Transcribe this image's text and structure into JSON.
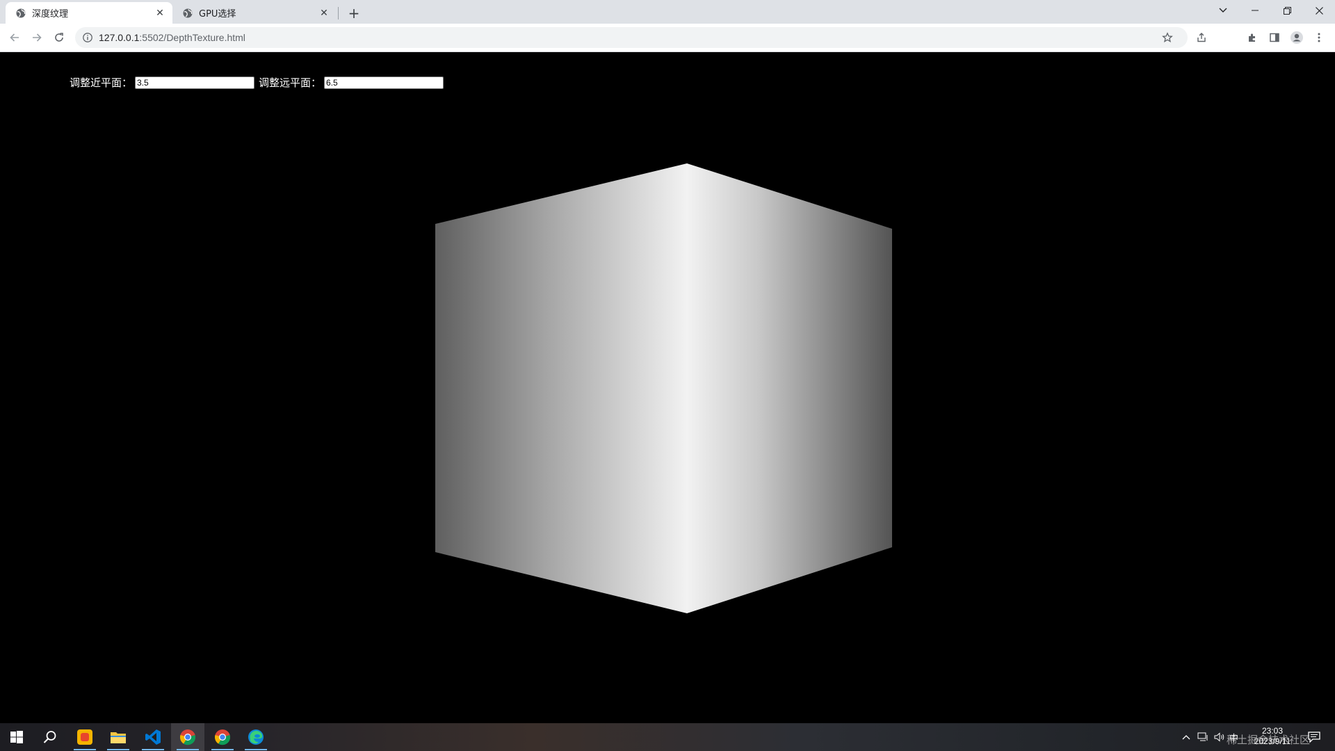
{
  "browser": {
    "tabs": [
      {
        "title": "深度纹理",
        "active": true
      },
      {
        "title": "GPU选择",
        "active": false
      }
    ],
    "new_tab_label": "+",
    "address": {
      "host": "127.0.0.1",
      "path": ":5502/DepthTexture.html"
    },
    "icons": [
      "back-icon",
      "forward-icon",
      "reload-icon",
      "info-icon",
      "share-icon",
      "star-icon",
      "extensions-icon",
      "side-panel-icon",
      "profile-icon",
      "menu-icon"
    ]
  },
  "page": {
    "near_label": "调整近平面：",
    "near_value": "3.5",
    "far_label": "调整远平面：",
    "far_value": "6.5",
    "scene_colors": {
      "background": "#000000",
      "edge_light": "#f2f2f2",
      "dark": "#5a5a5a"
    }
  },
  "taskbar": {
    "apps": [
      "start-icon",
      "search-icon",
      "app-orange-icon",
      "file-explorer-icon",
      "vscode-icon",
      "chrome-icon",
      "chrome-icon",
      "edge-icon"
    ],
    "tray_ime": "中",
    "time": "23:03",
    "date": "2023/9/11",
    "watermark": "稀土掘金技术社区"
  }
}
